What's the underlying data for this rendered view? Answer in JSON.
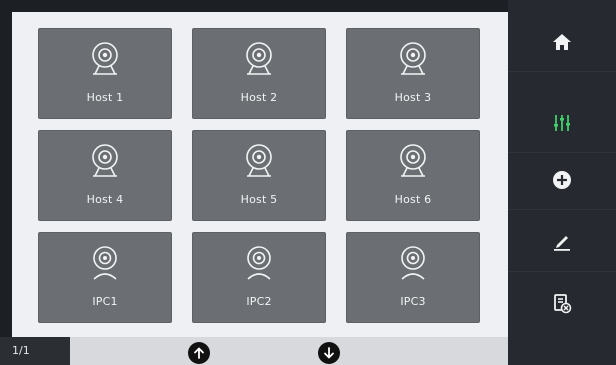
{
  "tiles": [
    {
      "label": "Host 1",
      "icon": "camera-icon"
    },
    {
      "label": "Host 2",
      "icon": "camera-icon"
    },
    {
      "label": "Host 3",
      "icon": "camera-icon"
    },
    {
      "label": "Host 4",
      "icon": "camera-icon"
    },
    {
      "label": "Host 5",
      "icon": "camera-icon"
    },
    {
      "label": "Host 6",
      "icon": "camera-icon"
    },
    {
      "label": "IPC1",
      "icon": "ip-camera-icon"
    },
    {
      "label": "IPC2",
      "icon": "ip-camera-icon"
    },
    {
      "label": "IPC3",
      "icon": "ip-camera-icon"
    }
  ],
  "footer": {
    "page_indicator": "1/1",
    "up_icon": "arrow-up-icon",
    "down_icon": "arrow-down-icon"
  },
  "sidebar": {
    "items": [
      {
        "icon": "home-icon"
      },
      {
        "icon": "sliders-icon",
        "color": "#3fd06a"
      },
      {
        "icon": "plus-circle-icon"
      },
      {
        "icon": "edit-icon"
      },
      {
        "icon": "delete-device-icon"
      }
    ]
  },
  "colors": {
    "tile_bg": "#6b6e72",
    "panel_bg": "#eef0f3",
    "sidebar_bg": "#262a30",
    "accent_green": "#3fd06a"
  }
}
